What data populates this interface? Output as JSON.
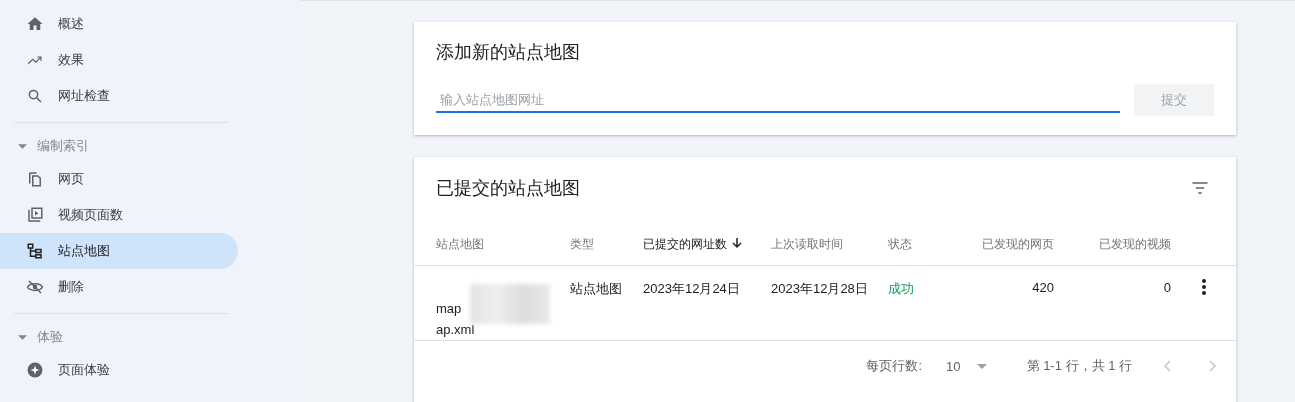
{
  "sidebar": {
    "groups": [
      {
        "items": [
          {
            "label": "概述",
            "selected": false
          },
          {
            "label": "效果",
            "selected": false
          },
          {
            "label": "网址检查",
            "selected": false
          }
        ]
      },
      {
        "title": "编制索引",
        "expanded": true,
        "items": [
          {
            "label": "网页",
            "selected": false
          },
          {
            "label": "视频页面数",
            "selected": false
          },
          {
            "label": "站点地图",
            "selected": true
          },
          {
            "label": "删除",
            "selected": false
          }
        ]
      },
      {
        "title": "体验",
        "expanded": true,
        "items": [
          {
            "label": "页面体验",
            "selected": false
          }
        ]
      }
    ]
  },
  "add_card": {
    "title": "添加新的站点地图",
    "placeholder": "输入站点地图网址",
    "submit": "提交",
    "submit_disabled": true
  },
  "table_card": {
    "title": "已提交的站点地图",
    "columns": [
      {
        "label": "站点地图",
        "sorted": false
      },
      {
        "label": "类型",
        "sorted": false
      },
      {
        "label": "已提交的网址数",
        "sorted": true
      },
      {
        "label": "上次读取时间",
        "sorted": false
      },
      {
        "label": "状态",
        "sorted": false
      },
      {
        "label": "已发现的网页",
        "sorted": false
      },
      {
        "label": "已发现的视频",
        "sorted": false
      }
    ],
    "rows": [
      {
        "sitemap": [
          "map",
          "ap.xml"
        ],
        "type": "站点地图",
        "submitted": "2023年12月24日",
        "last_read": "2023年12月28日",
        "status": "成功",
        "pages": "420",
        "videos": "0"
      }
    ],
    "footer": {
      "rows_label": "每页行数:",
      "rows_value": "10",
      "range": "第 1-1 行，共 1 行",
      "prev_disabled": true,
      "next_disabled": true
    }
  }
}
